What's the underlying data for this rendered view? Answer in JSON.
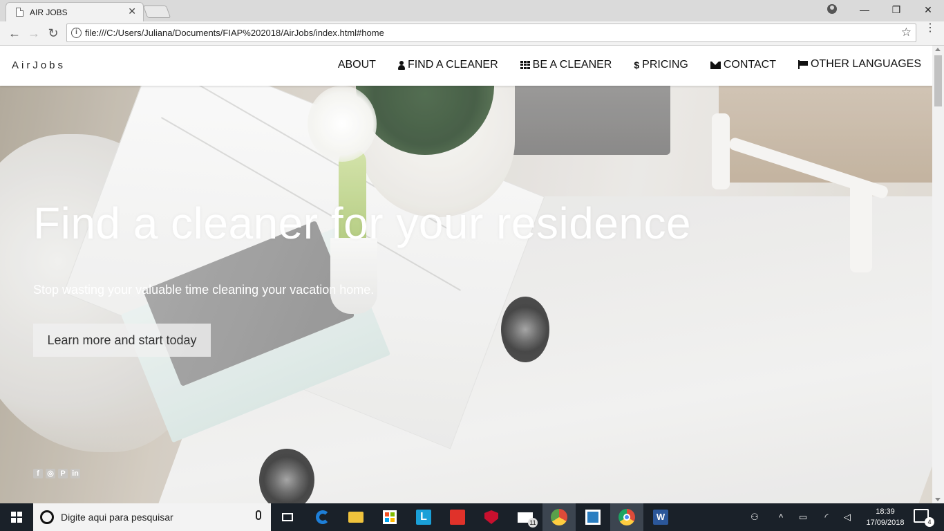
{
  "browser": {
    "tab_title": "AIR JOBS",
    "tab_close": "✕",
    "url": "file:///C:/Users/Juliana/Documents/FIAP%202018/AirJobs/index.html#home",
    "back": "←",
    "forward": "→",
    "reload": "↻",
    "star": "☆",
    "info": "i",
    "menu": "⋮",
    "minimize": "—",
    "maximize": "❐",
    "close": "✕"
  },
  "site": {
    "brand": "AirJobs",
    "nav": [
      {
        "label": "ABOUT",
        "icon": "none"
      },
      {
        "label": "FIND A CLEANER",
        "icon": "user-icon"
      },
      {
        "label": "BE A CLEANER",
        "icon": "grid-icon"
      },
      {
        "label": "PRICING",
        "icon": "dollar-icon",
        "glyph": "$"
      },
      {
        "label": "CONTACT",
        "icon": "envelope-icon"
      },
      {
        "label": "OTHER LANGUAGES",
        "icon": "flag-icon"
      }
    ],
    "hero": {
      "title": "Find a cleaner for your residence",
      "subtitle": "Stop wasting your valuable time cleaning your vacation home.",
      "button": "Learn more and start today"
    },
    "social": {
      "facebook": "f",
      "instagram": "◎",
      "pinterest": "P",
      "linkedin": "in"
    }
  },
  "taskbar": {
    "search_placeholder": "Digite aqui para pesquisar",
    "mail_badge": "11",
    "time": "18:39",
    "date": "17/09/2018",
    "notifications": "4",
    "apps": [
      {
        "name": "task-view-icon"
      },
      {
        "name": "edge-icon",
        "color": "#1e7fd8"
      },
      {
        "name": "file-explorer-icon",
        "color": "#f0c33c"
      },
      {
        "name": "store-icon",
        "color": "#ffffff"
      },
      {
        "name": "l-app-icon",
        "color": "#1aa0d8"
      },
      {
        "name": "office-app-icon",
        "color": "#e0322a"
      },
      {
        "name": "mcafee-icon",
        "color": "#c8102e"
      },
      {
        "name": "mail-icon",
        "color": "#ffffff"
      },
      {
        "name": "chrome-profile-icon",
        "color": "#5aa04a"
      },
      {
        "name": "bracket-app-icon",
        "color": "#2a7ec1"
      },
      {
        "name": "chrome-icon",
        "color": "#dd4b39"
      },
      {
        "name": "word-icon",
        "color": "#2b579a"
      }
    ]
  }
}
